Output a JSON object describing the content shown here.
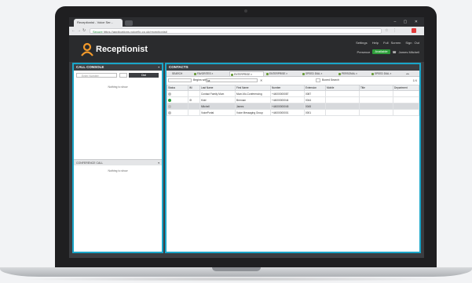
{
  "browser": {
    "tab_title": "Receptionist - Voice Ser...",
    "url_secure": "Secure",
    "url_path": "https://applications.voiceflo.co.uk/receptionist/"
  },
  "app": {
    "brand": "Receptionist",
    "top_links": [
      "Settings",
      "Help",
      "Full Screen",
      "Sign Out"
    ],
    "presence_label": "Presence",
    "presence_value": "Available",
    "user_name": "James Mitchell"
  },
  "call_console": {
    "title": "CALL CONSOLE",
    "input_placeholder": "Enter Number",
    "dial_button": "Dial",
    "no_data": "Nothing to show",
    "conference_title": "CONFERENCE CALL",
    "conference_no_data": "Nothing to show"
  },
  "contacts": {
    "title": "CONTACTS",
    "tabs": [
      {
        "label": "SEARCH"
      },
      {
        "label": "FAVORITES"
      },
      {
        "label": "ENTERPRISE"
      },
      {
        "label": "ENTERPRISE"
      },
      {
        "label": "SPEED DIAL"
      },
      {
        "label": "PERSONAL"
      },
      {
        "label": "SPEED DIAL"
      }
    ],
    "begins_with_label": "Begins with",
    "begins_with_value": "All",
    "clear_symbol": "✕",
    "boxed_search_label": "Boxed Search",
    "pager": "1/4",
    "columns": [
      "Status",
      "IM",
      "Last Name",
      "First Name",
      "Number",
      "Extension",
      "Mobile",
      "Title",
      "Department"
    ],
    "rows": [
      {
        "status": "grey",
        "im": "",
        "last": "Contact Family Mum",
        "first": "Mum-Mo-Conferencing",
        "number": "+44000000087",
        "ext": "0087",
        "mobile": "",
        "title": "",
        "dept": ""
      },
      {
        "status": "green",
        "im": "dnd",
        "last": "Kidd",
        "first": "Brennan",
        "number": "+44000000044",
        "ext": "0044",
        "mobile": "",
        "title": "",
        "dept": ""
      },
      {
        "status": "grey",
        "im": "",
        "last": "Mitchell",
        "first": "James",
        "number": "+44000000045",
        "ext": "0045",
        "mobile": "",
        "title": "",
        "dept": ""
      },
      {
        "status": "grey",
        "im": "",
        "last": "VoicePortal",
        "first": "Voice Messaging Group",
        "number": "+44000000001",
        "ext": "0001",
        "mobile": "",
        "title": "",
        "dept": ""
      }
    ]
  },
  "colors": {
    "accent": "#19a6c9",
    "logo": "#f39a2b",
    "available": "#2e9e3b"
  }
}
